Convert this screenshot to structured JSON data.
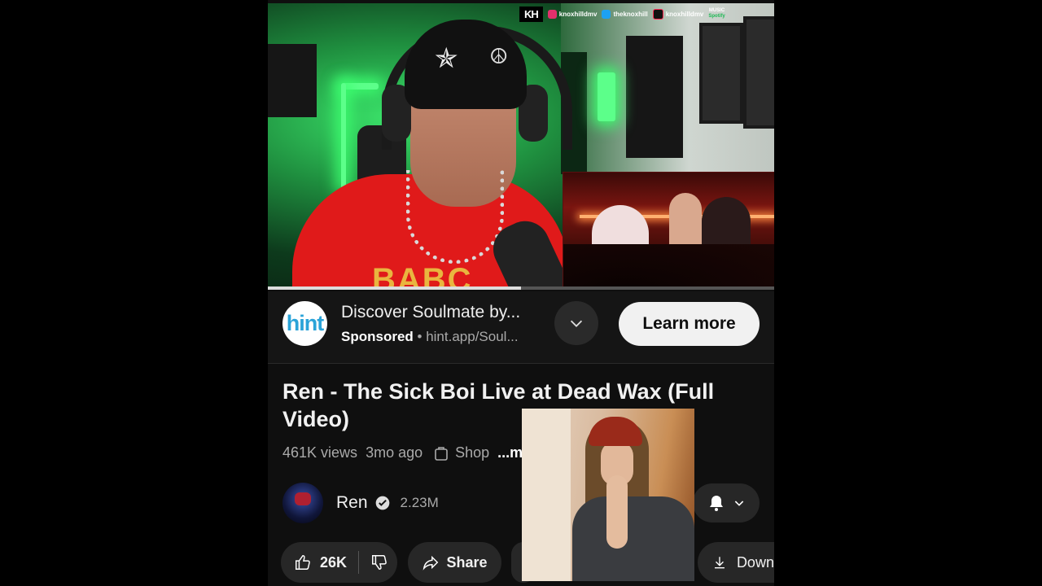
{
  "overlay": {
    "brand_logo": "KH",
    "socials": [
      {
        "icon": "instagram-icon",
        "handle": "knoxhilldmv",
        "color": "#e1306c"
      },
      {
        "icon": "twitter-icon",
        "handle": "theknoxhill",
        "color": "#1da1f2"
      },
      {
        "icon": "tiktok-icon",
        "handle": "knoxhilldmv",
        "color": "#111111"
      },
      {
        "icon": "apple-music-icon",
        "handle": "MUSIC",
        "color": "#fc3c44"
      }
    ],
    "spotify_text": "Spotify",
    "shirt_text": "BABC"
  },
  "player": {
    "progress_fraction": 0.5
  },
  "ad": {
    "logo_text": "hint",
    "title": "Discover Soulmate by...",
    "sponsored_label": "Sponsored",
    "url": "hint.app/Soul...",
    "cta_label": "Learn more"
  },
  "video": {
    "title": "Ren - The Sick Boi Live at Dead Wax (Full Video)",
    "views": "461K views",
    "age": "3mo ago",
    "shop_label": "Shop",
    "more_label": "...more"
  },
  "channel": {
    "name": "Ren",
    "subscribers": "2.23M"
  },
  "actions": {
    "likes": "26K",
    "share_label": "Share",
    "download_label": "Download"
  },
  "colors": {
    "background": "#0f0f0f",
    "pill": "#272727",
    "cta_bg": "#f1f1f1",
    "ad_logo": "#2aa3d8"
  }
}
